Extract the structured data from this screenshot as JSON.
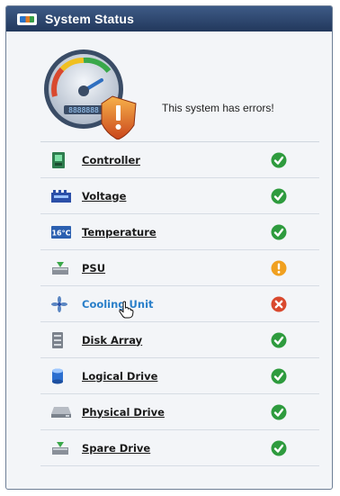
{
  "window": {
    "title": "System Status"
  },
  "summary": {
    "message": "This system has errors!"
  },
  "gauge": {
    "display_text": "8888888"
  },
  "components": [
    {
      "label": "Controller",
      "icon": "controller-icon",
      "status": "ok"
    },
    {
      "label": "Voltage",
      "icon": "voltage-icon",
      "status": "ok"
    },
    {
      "label": "Temperature",
      "icon": "temperature-icon",
      "status": "ok"
    },
    {
      "label": "PSU",
      "icon": "psu-icon",
      "status": "warning"
    },
    {
      "label": "Cooling Unit",
      "icon": "fan-icon",
      "status": "error"
    },
    {
      "label": "Disk Array",
      "icon": "disk-array-icon",
      "status": "ok"
    },
    {
      "label": "Logical Drive",
      "icon": "logical-drive-icon",
      "status": "ok"
    },
    {
      "label": "Physical Drive",
      "icon": "physical-drive-icon",
      "status": "ok"
    },
    {
      "label": "Spare Drive",
      "icon": "spare-drive-icon",
      "status": "ok"
    }
  ],
  "colors": {
    "ok": "#2e9b3e",
    "warning": "#f0a020",
    "error": "#d9492e",
    "header": "#2c4670",
    "hover_link": "#2a7fc9"
  }
}
